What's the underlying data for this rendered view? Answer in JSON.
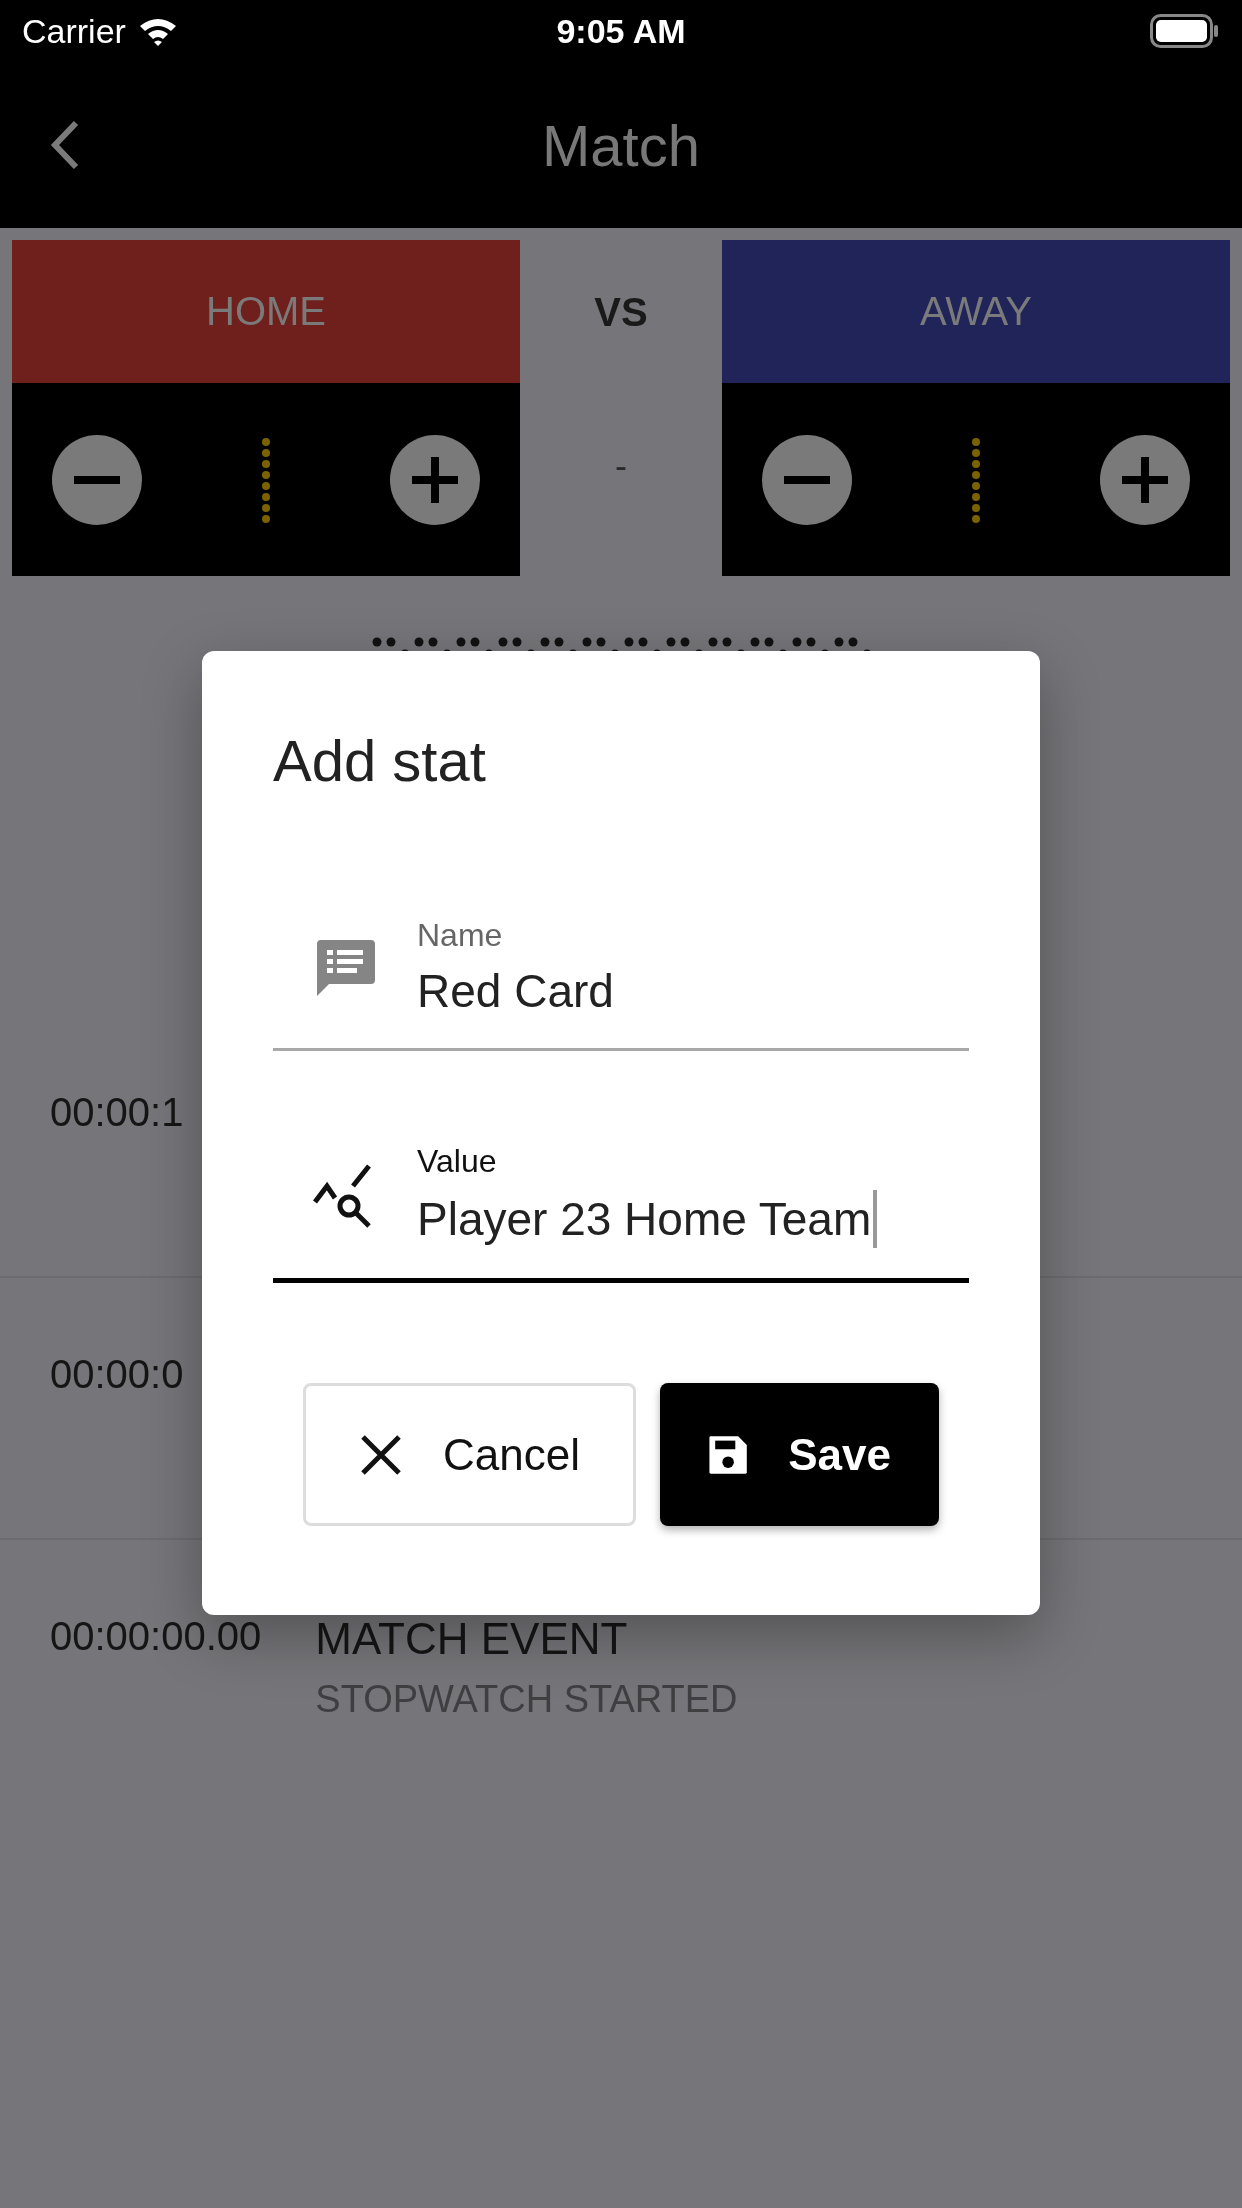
{
  "status_bar": {
    "carrier": "Carrier",
    "time": "9:05 AM"
  },
  "nav": {
    "title": "Match"
  },
  "scoreboard": {
    "vs": "VS",
    "separator": "-",
    "teams": [
      {
        "name": "HOME",
        "color": "#70201c"
      },
      {
        "name": "AWAY",
        "color": "#202459"
      }
    ]
  },
  "events": [
    {
      "time": "00:00:1"
    },
    {
      "time": "00:00:0"
    },
    {
      "time": "00:00:00.00",
      "title": "MATCH EVENT",
      "detail": "STOPWATCH STARTED"
    }
  ],
  "dialog": {
    "title": "Add stat",
    "fields": [
      {
        "kind": "name",
        "label": "Name",
        "value": "Red Card",
        "focused": false
      },
      {
        "kind": "value",
        "label": "Value",
        "value": "Player 23 Home Team",
        "focused": true
      }
    ],
    "buttons": [
      {
        "kind": "cancel",
        "label": "Cancel"
      },
      {
        "kind": "save",
        "label": "Save"
      }
    ]
  }
}
